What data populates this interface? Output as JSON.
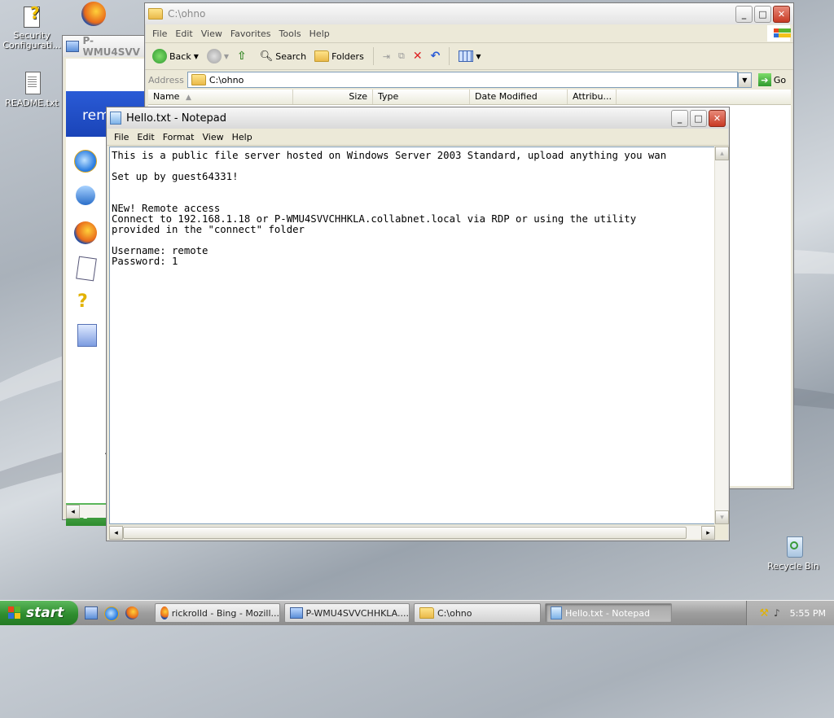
{
  "desktop": {
    "icons": [
      {
        "label": "Security Configurati..."
      },
      {
        "label": "README.txt"
      },
      {
        "label": "Recycle Bin"
      }
    ]
  },
  "bg_window": {
    "title": "P-WMU4SVV",
    "partial_text": "rem",
    "start_label": "st",
    "snippet_a": "A"
  },
  "explorer": {
    "title": "C:\\ohno",
    "menu": [
      "File",
      "Edit",
      "View",
      "Favorites",
      "Tools",
      "Help"
    ],
    "toolbar": {
      "back": "Back",
      "search": "Search",
      "folders": "Folders"
    },
    "address_label": "Address",
    "address_value": "C:\\ohno",
    "go_label": "Go",
    "columns": [
      "Name",
      "Size",
      "Type",
      "Date Modified",
      "Attribu..."
    ]
  },
  "notepad": {
    "title": "Hello.txt - Notepad",
    "menu": [
      "File",
      "Edit",
      "Format",
      "View",
      "Help"
    ],
    "lines": [
      "This is a public file server hosted on Windows Server 2003 Standard, upload anything you wan",
      "",
      "Set up by guest64331!",
      "",
      "",
      "NEw! Remote access",
      "Connect to 192.168.1.18 or P-WMU4SVVCHHKLA.collabnet.local via RDP or using the utility",
      "provided in the \"connect\" folder",
      "",
      "Username: remote",
      "Password: 1"
    ]
  },
  "taskbar": {
    "start": "start",
    "tasks": [
      {
        "label": "rickrolld - Bing - Mozill...",
        "icon": "firefox-icon"
      },
      {
        "label": "P-WMU4SVVCHHKLA....",
        "icon": "remote-desktop-icon"
      },
      {
        "label": "C:\\ohno",
        "icon": "folder-icon"
      },
      {
        "label": "Hello.txt - Notepad",
        "icon": "notepad-icon"
      }
    ],
    "clock": "5:55 PM"
  }
}
